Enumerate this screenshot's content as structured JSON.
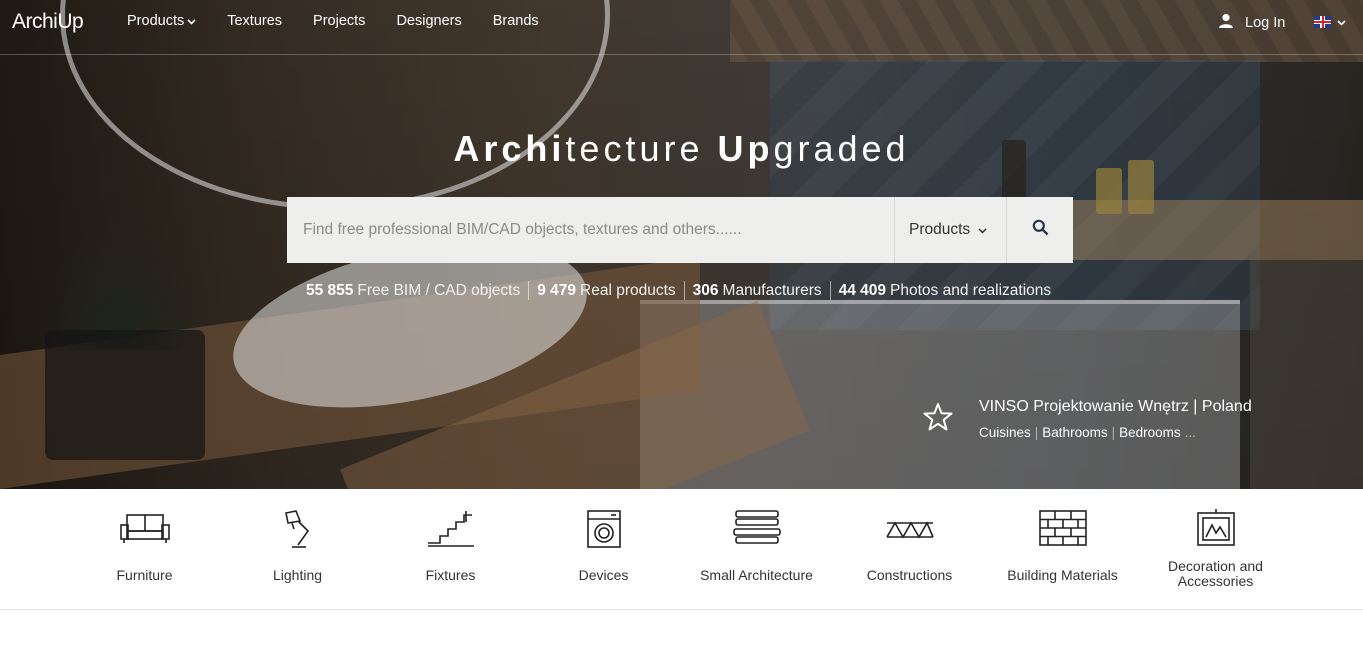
{
  "nav": {
    "logo": "ArchiUp",
    "links": [
      "Products",
      "Textures",
      "Projects",
      "Designers",
      "Brands"
    ],
    "login": "Log In",
    "language": "EN"
  },
  "hero": {
    "headline_parts": [
      {
        "text": "Archi",
        "bold": true
      },
      {
        "text": "tecture ",
        "bold": false
      },
      {
        "text": "Up",
        "bold": true
      },
      {
        "text": "graded",
        "bold": false
      }
    ],
    "search": {
      "placeholder": "Find free professional BIM/CAD objects, textures and others......",
      "category": "Products"
    },
    "stats": [
      {
        "value": "55 855",
        "label": "Free BIM / CAD objects"
      },
      {
        "value": "9 479",
        "label": "Real products"
      },
      {
        "value": "306",
        "label": "Manufacturers"
      },
      {
        "value": "44 409",
        "label": "Photos and realizations"
      }
    ],
    "featured": {
      "name": "VINSO Projektowanie Wnętrz | Poland",
      "tags": [
        "Cuisines",
        "Bathrooms",
        "Bedrooms"
      ],
      "more": "..."
    }
  },
  "categories": [
    {
      "label": "Furniture",
      "icon": "sofa-icon"
    },
    {
      "label": "Lighting",
      "icon": "desk-lamp-icon"
    },
    {
      "label": "Fixtures",
      "icon": "stairs-icon"
    },
    {
      "label": "Devices",
      "icon": "washing-machine-icon"
    },
    {
      "label": "Small Architecture",
      "icon": "bench-icon"
    },
    {
      "label": "Constructions",
      "icon": "truss-icon"
    },
    {
      "label": "Building Materials",
      "icon": "bricks-icon"
    },
    {
      "label": "Decoration and Accessories",
      "icon": "picture-frame-icon"
    }
  ]
}
